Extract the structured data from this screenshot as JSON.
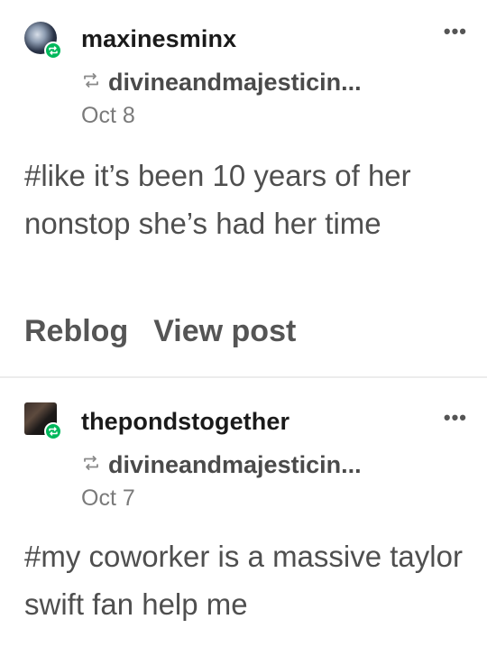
{
  "posts": [
    {
      "username": "maxinesminx",
      "source": "divineandmajesticin...",
      "date": "Oct 8",
      "tags": "#like it’s been 10 years of her nonstop she’s had her time",
      "actions": [
        "Reblog",
        "View post"
      ],
      "more_label": "•••"
    },
    {
      "username": "thepondstogether",
      "source": "divineandmajesticin...",
      "date": "Oct 7",
      "tags": "#my coworker is a massive taylor swift fan help me",
      "more_label": "•••"
    }
  ],
  "colors": {
    "reblog_badge": "#00b85c",
    "username": "#1a1a1a",
    "secondary_text": "#4f4f4f",
    "date_text": "#7a7a7a",
    "divider": "#ececec"
  },
  "icons": {
    "reblog": "reblog-arrows-icon",
    "more": "more-horizontal-icon"
  }
}
